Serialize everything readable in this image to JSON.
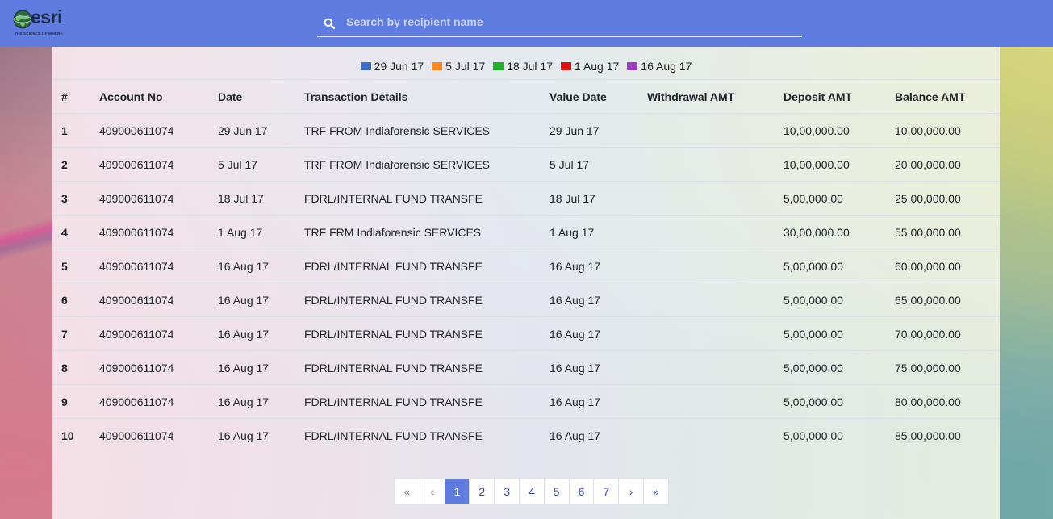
{
  "header": {
    "logo_text": "esri",
    "logo_tagline": "THE SCIENCE OF WHERE",
    "search_placeholder": "Search by recipient name",
    "search_value": ""
  },
  "colors": {
    "header_bg": "#5f7ce0",
    "active_page": "#5f7ce0"
  },
  "legend": [
    {
      "label": "29 Jun 17",
      "color": "#3d6fc4"
    },
    {
      "label": "5 Jul 17",
      "color": "#ff8a1f"
    },
    {
      "label": "18 Jul 17",
      "color": "#1fb32a"
    },
    {
      "label": "1 Aug 17",
      "color": "#dd1010"
    },
    {
      "label": "16 Aug 17",
      "color": "#9a3cc4"
    }
  ],
  "table": {
    "headers": [
      "#",
      "Account No",
      "Date",
      "Transaction Details",
      "Value Date",
      "Withdrawal AMT",
      "Deposit AMT",
      "Balance AMT"
    ],
    "rows": [
      [
        "1",
        "409000611074",
        "29 Jun 17",
        "TRF FROM Indiaforensic SERVICES",
        "29 Jun 17",
        "",
        "10,00,000.00",
        "10,00,000.00"
      ],
      [
        "2",
        "409000611074",
        "5 Jul 17",
        "TRF FROM Indiaforensic SERVICES",
        "5 Jul 17",
        "",
        "10,00,000.00",
        "20,00,000.00"
      ],
      [
        "3",
        "409000611074",
        "18 Jul 17",
        "FDRL/INTERNAL FUND TRANSFE",
        "18 Jul 17",
        "",
        "5,00,000.00",
        "25,00,000.00"
      ],
      [
        "4",
        "409000611074",
        "1 Aug 17",
        "TRF FRM Indiaforensic SERVICES",
        "1 Aug 17",
        "",
        "30,00,000.00",
        "55,00,000.00"
      ],
      [
        "5",
        "409000611074",
        "16 Aug 17",
        "FDRL/INTERNAL FUND TRANSFE",
        "16 Aug 17",
        "",
        "5,00,000.00",
        "60,00,000.00"
      ],
      [
        "6",
        "409000611074",
        "16 Aug 17",
        "FDRL/INTERNAL FUND TRANSFE",
        "16 Aug 17",
        "",
        "5,00,000.00",
        "65,00,000.00"
      ],
      [
        "7",
        "409000611074",
        "16 Aug 17",
        "FDRL/INTERNAL FUND TRANSFE",
        "16 Aug 17",
        "",
        "5,00,000.00",
        "70,00,000.00"
      ],
      [
        "8",
        "409000611074",
        "16 Aug 17",
        "FDRL/INTERNAL FUND TRANSFE",
        "16 Aug 17",
        "",
        "5,00,000.00",
        "75,00,000.00"
      ],
      [
        "9",
        "409000611074",
        "16 Aug 17",
        "FDRL/INTERNAL FUND TRANSFE",
        "16 Aug 17",
        "",
        "5,00,000.00",
        "80,00,000.00"
      ],
      [
        "10",
        "409000611074",
        "16 Aug 17",
        "FDRL/INTERNAL FUND TRANSFE",
        "16 Aug 17",
        "",
        "5,00,000.00",
        "85,00,000.00"
      ]
    ]
  },
  "pagination": {
    "first": "«",
    "prev": "‹",
    "pages": [
      "1",
      "2",
      "3",
      "4",
      "5",
      "6",
      "7"
    ],
    "active_page": "1",
    "next": "›",
    "last": "»"
  }
}
